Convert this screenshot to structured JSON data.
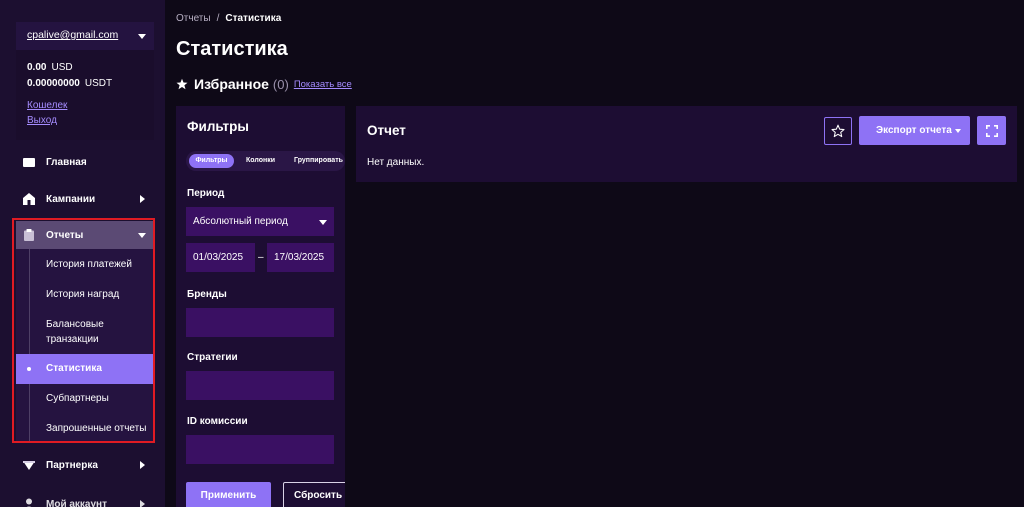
{
  "account": {
    "email": "cpalive@gmail.com",
    "balances": [
      {
        "amount": "0.00",
        "currency": "USD"
      },
      {
        "amount": "0.00000000",
        "currency": "USDT"
      }
    ],
    "wallet_link": "Кошелек",
    "logout_link": "Выход"
  },
  "sidebar": {
    "home": "Главная",
    "campaigns": "Кампании",
    "reports": "Отчеты",
    "reports_sub": {
      "payments_history": "История платежей",
      "rewards_history": "История наград",
      "balance_transactions": "Балансовые транзакции",
      "statistics": "Статистика",
      "subpartners": "Субпартнеры",
      "requested_reports": "Запрошенные отчеты"
    },
    "partner": "Партнерка",
    "my_account": "Мой аккаунт"
  },
  "breadcrumb": {
    "parent": "Отчеты",
    "separator": "/",
    "current": "Статистика"
  },
  "page": {
    "title": "Статистика",
    "favorites_label": "Избранное",
    "favorites_count": "(0)",
    "show_all": "Показать все"
  },
  "filters": {
    "title": "Фильтры",
    "tabs": [
      "Фильтры",
      "Колонки",
      "Группировать"
    ],
    "period_label": "Период",
    "period_value": "Абсолютный период",
    "date_from": "01/03/2025",
    "date_dash": "–",
    "date_to": "17/03/2025",
    "brands_label": "Бренды",
    "strategies_label": "Стратегии",
    "commission_label": "ID комиссии",
    "apply": "Применить",
    "reset": "Сбросить"
  },
  "report": {
    "title": "Отчет",
    "empty_text": "Нет данных.",
    "export_button": "Экспорт отчета"
  },
  "colors": {
    "accent": "#8e72f5",
    "link": "#a58cff",
    "panel": "#1d0d33",
    "input": "#3a1063",
    "highlight": "#e01b23"
  }
}
